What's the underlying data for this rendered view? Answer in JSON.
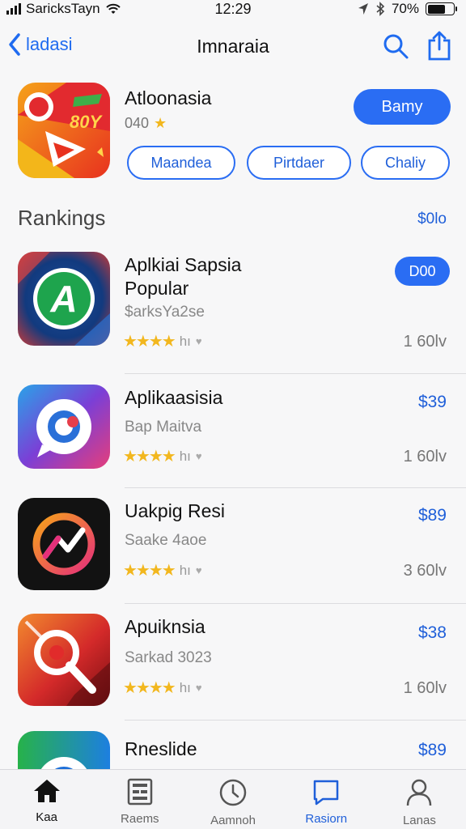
{
  "status_bar": {
    "carrier": "SaricksTayn",
    "time": "12:29",
    "battery": "70%",
    "battery_level": 0.7
  },
  "nav": {
    "back_label": "ladasi",
    "title": "Imnaraia"
  },
  "featured": {
    "name": "Atloonasia",
    "rating": "040",
    "buy_label": "Bamy",
    "chips": [
      "Maandea",
      "Pirtdaer",
      "Chaliy"
    ]
  },
  "rankings": {
    "title": "Rankings",
    "link": "$0lo"
  },
  "apps": [
    {
      "name_line1": "Aplkiai Sapsia",
      "name_line2": "Popular",
      "sub": "$arksYa2se",
      "rating_label": "hı",
      "stars": 3.5,
      "count": "1 60lv",
      "action": "D00"
    },
    {
      "name_line1": "Aplikaasisia",
      "sub": "Bap Maitva",
      "rating_label": "hı",
      "stars": 4,
      "count": "1 60lv",
      "price": "$39"
    },
    {
      "name_line1": "Uakpig Resi",
      "sub": "Saake 4aoe",
      "rating_label": "hı",
      "stars": 3.5,
      "count": "3 60lv",
      "price": "$89"
    },
    {
      "name_line1": "Apuiknsia",
      "sub": "Sarkad 3023",
      "rating_label": "hı",
      "stars": 3.5,
      "count": "1 60lv",
      "price": "$38"
    },
    {
      "name_line1": "Rneslide",
      "price": "$89"
    }
  ],
  "tabs": [
    {
      "label": "Kaa",
      "icon": "home-icon"
    },
    {
      "label": "Raems",
      "icon": "grid-icon"
    },
    {
      "label": "Aamnoh",
      "icon": "clock-icon"
    },
    {
      "label": "Rasiorn",
      "icon": "chat-icon"
    },
    {
      "label": "Lanas",
      "icon": "person-icon"
    }
  ],
  "colors": {
    "accent": "#2a6df3",
    "star": "#f2b71e"
  }
}
